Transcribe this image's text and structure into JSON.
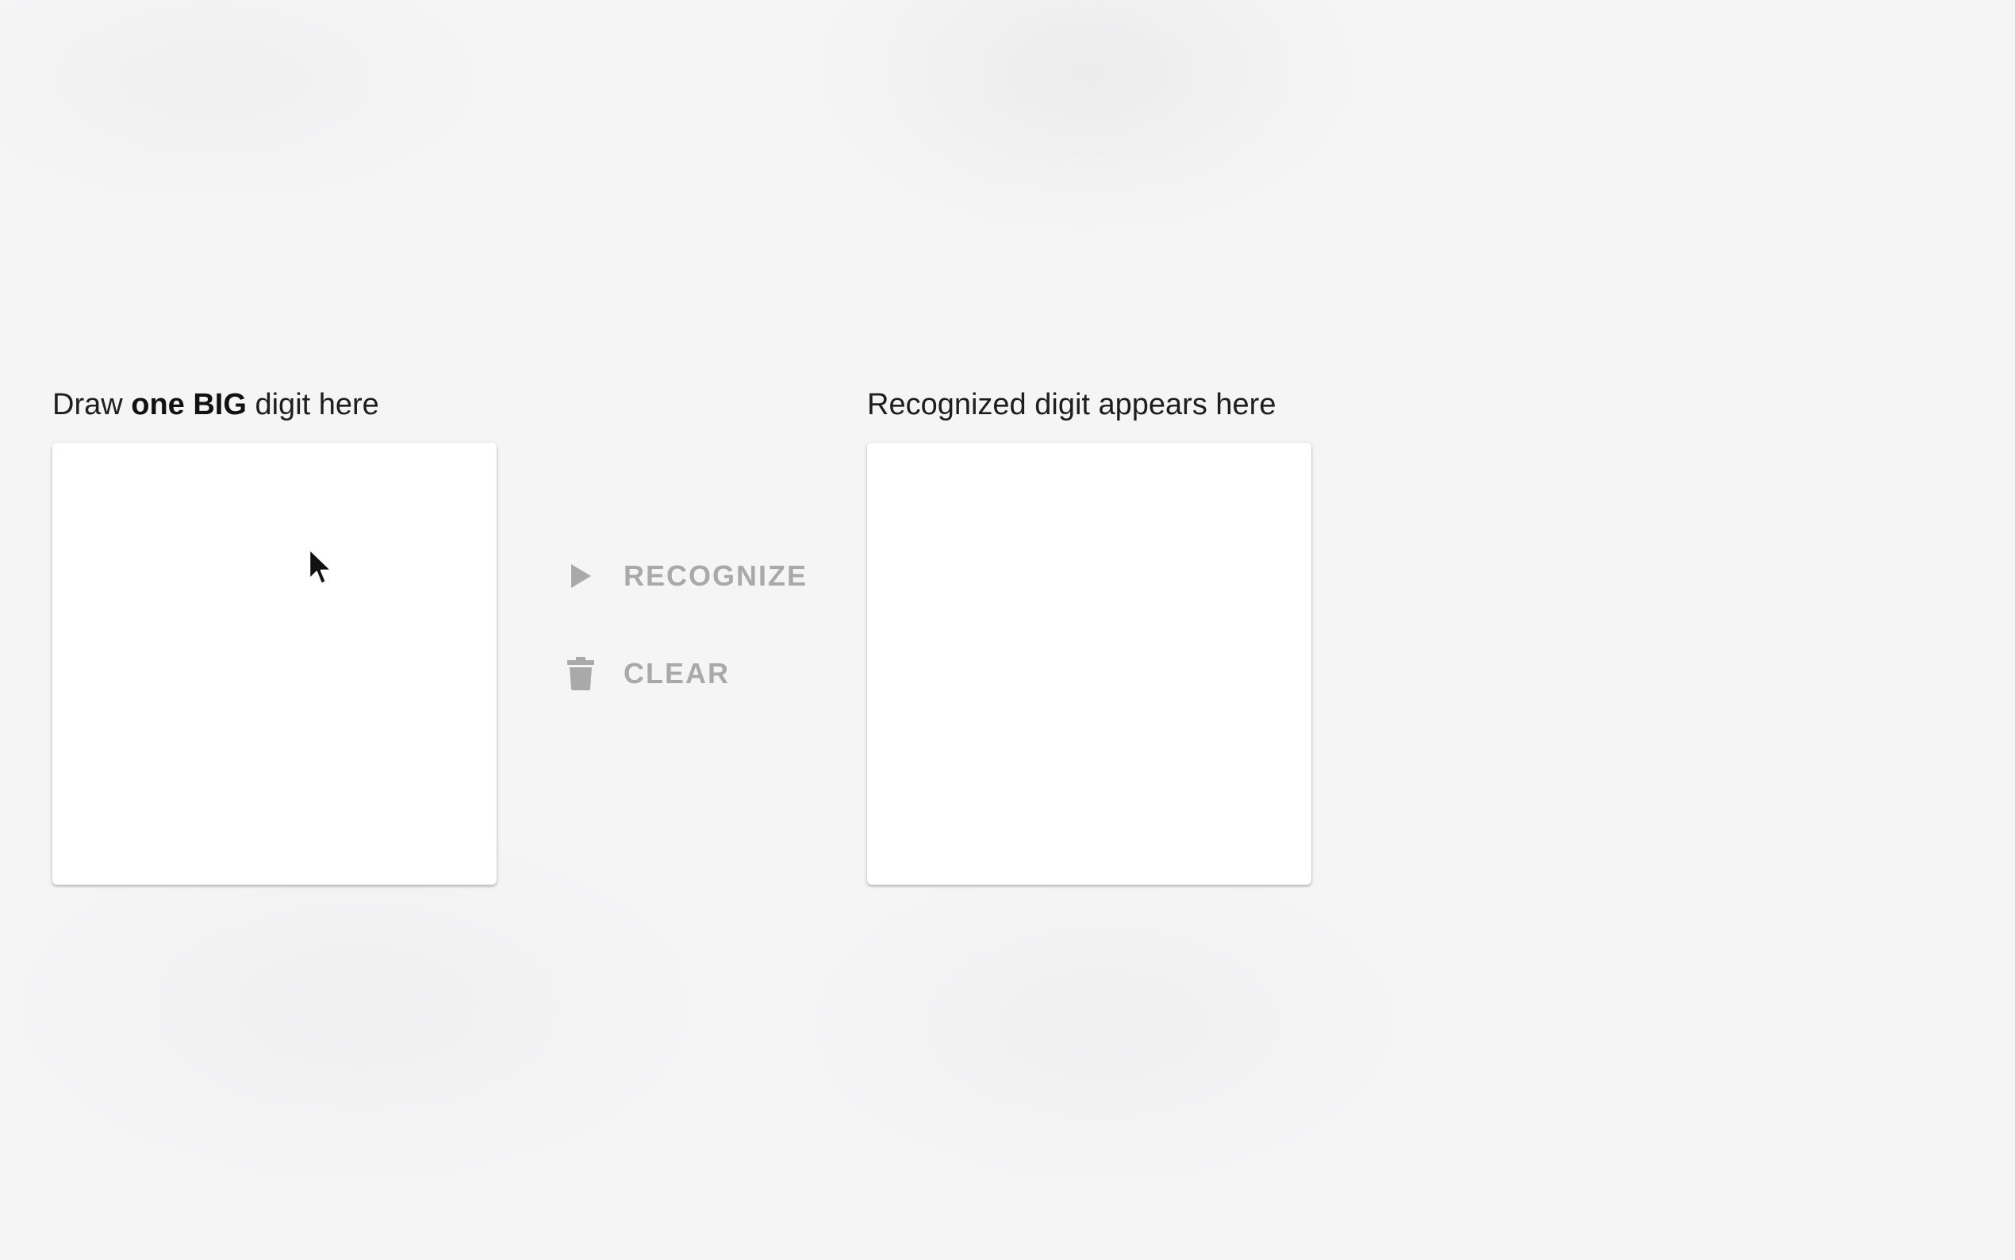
{
  "draw_panel": {
    "label_prefix": "Draw ",
    "label_bold": "one BIG",
    "label_suffix": " digit here"
  },
  "result_panel": {
    "label": "Recognized digit appears here"
  },
  "actions": {
    "recognize": {
      "label": "RECOGNIZE",
      "icon": "play-icon",
      "enabled": false
    },
    "clear": {
      "label": "CLEAR",
      "icon": "trash-icon",
      "enabled": false
    }
  },
  "colors": {
    "background": "#f5f5f6",
    "card": "#ffffff",
    "disabled_text": "#a9a9a9",
    "label_text": "#1e1e1e"
  }
}
